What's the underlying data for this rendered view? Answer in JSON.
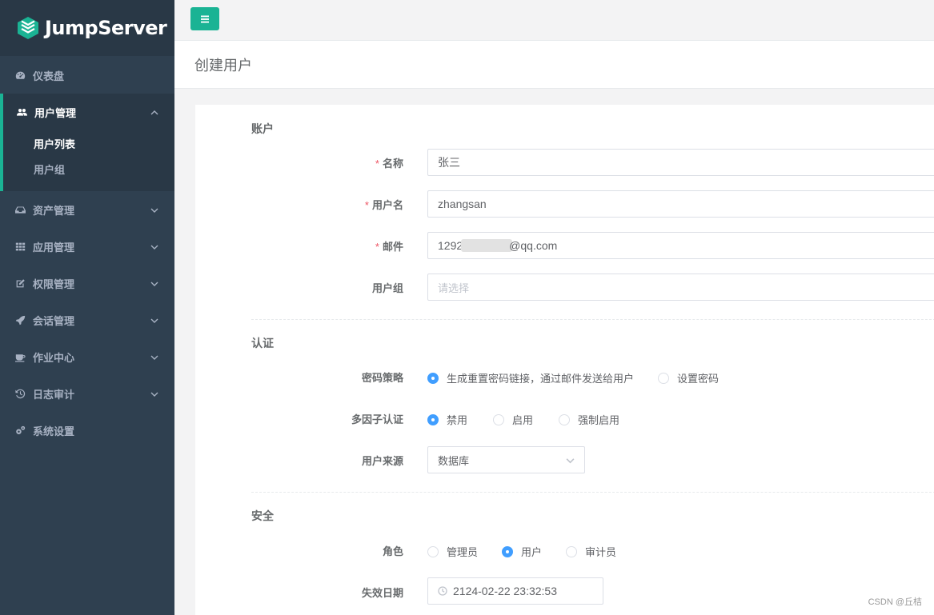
{
  "app": {
    "logo_text": "JumpServer"
  },
  "sidebar": {
    "items": [
      {
        "label": "仪表盘",
        "icon": "dashboard-icon"
      },
      {
        "label": "用户管理",
        "icon": "users-icon",
        "expanded": true,
        "children": [
          {
            "label": "用户列表",
            "active": true
          },
          {
            "label": "用户组",
            "active": false
          }
        ]
      },
      {
        "label": "资产管理",
        "icon": "inbox-icon"
      },
      {
        "label": "应用管理",
        "icon": "grid-icon"
      },
      {
        "label": "权限管理",
        "icon": "edit-icon"
      },
      {
        "label": "会话管理",
        "icon": "rocket-icon"
      },
      {
        "label": "作业中心",
        "icon": "coffee-icon"
      },
      {
        "label": "日志审计",
        "icon": "history-icon"
      },
      {
        "label": "系统设置",
        "icon": "gears-icon"
      }
    ]
  },
  "header": {
    "title": "创建用户"
  },
  "form": {
    "sections": {
      "account": "账户",
      "auth": "认证",
      "security": "安全"
    },
    "name": {
      "label": "名称",
      "value": "张三",
      "required": true
    },
    "username": {
      "label": "用户名",
      "value": "zhangsan",
      "required": true
    },
    "email": {
      "label": "邮件",
      "value_prefix": "1292",
      "value_suffix": "@qq.com",
      "required": true
    },
    "user_group": {
      "label": "用户组",
      "placeholder": "请选择"
    },
    "password_strategy": {
      "label": "密码策略",
      "options": [
        "生成重置密码链接，通过邮件发送给用户",
        "设置密码"
      ],
      "selected": "生成重置密码链接，通过邮件发送给用户"
    },
    "mfa": {
      "label": "多因子认证",
      "options": [
        "禁用",
        "启用",
        "强制启用"
      ],
      "selected": "禁用"
    },
    "source": {
      "label": "用户来源",
      "value": "数据库"
    },
    "role": {
      "label": "角色",
      "options": [
        "管理员",
        "用户",
        "审计员"
      ],
      "selected": "用户"
    },
    "expiry": {
      "label": "失效日期",
      "value": "2124-02-22 23:32:53"
    }
  },
  "watermark": "CSDN @丘桔",
  "colors": {
    "sidebar_bg": "#2f4050",
    "accent": "#1ab394",
    "radio_checked": "#409eff",
    "required": "#ed5565"
  }
}
